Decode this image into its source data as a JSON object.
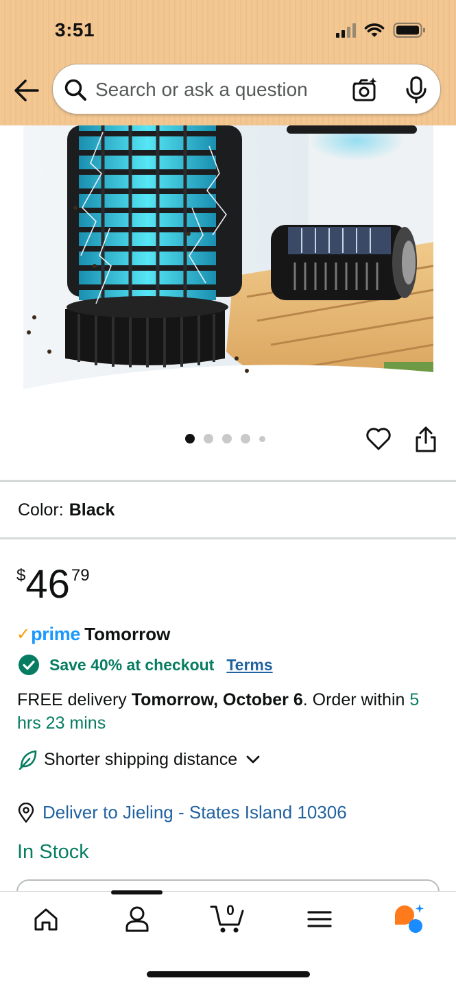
{
  "status_bar": {
    "time": "3:51"
  },
  "search": {
    "placeholder": "Search or ask a question"
  },
  "carousel": {
    "dot_count": 5,
    "active_index": 0
  },
  "product": {
    "color_label": "Color:",
    "color_value": "Black"
  },
  "price": {
    "symbol": "$",
    "whole": "46",
    "fraction": "79"
  },
  "prime": {
    "logo_text": "prime",
    "delivery_label": "Tomorrow"
  },
  "promo": {
    "text": "Save 40% at checkout",
    "terms_label": "Terms"
  },
  "delivery": {
    "prefix": "FREE delivery ",
    "date": "Tomorrow, October 6",
    "middle": ". Order within ",
    "countdown": "5 hrs 23 mins"
  },
  "shipping": {
    "label": "Shorter shipping distance"
  },
  "deliver_to": {
    "label": "Deliver to Jieling - States Island 10306"
  },
  "stock": {
    "label": "In Stock"
  },
  "cart": {
    "count": "0"
  },
  "colors": {
    "header_bg": "#f2c792",
    "link": "#2162a1",
    "success_green": "#067d62",
    "prime_blue": "#1a98ff"
  },
  "icons": [
    "back-arrow-icon",
    "search-icon",
    "camera-icon",
    "mic-icon",
    "heart-icon",
    "share-icon",
    "check-circle-icon",
    "leaf-icon",
    "chevron-down-icon",
    "location-pin-icon",
    "home-icon",
    "profile-icon",
    "cart-icon",
    "menu-icon",
    "rufus-icon"
  ]
}
